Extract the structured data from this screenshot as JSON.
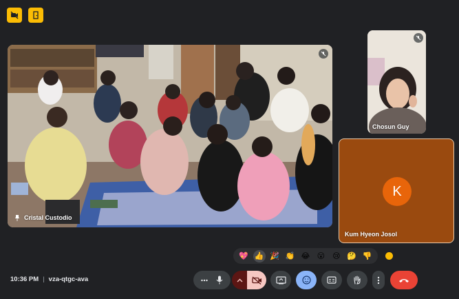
{
  "top_badges": [
    {
      "icon": "no-recording-icon"
    },
    {
      "icon": "door-icon"
    }
  ],
  "participants": {
    "main": {
      "name": "Cristal Custodio",
      "icon": "pin-icon"
    },
    "top_right": {
      "name": "Chosun Guy"
    },
    "bottom_right": {
      "name": "Kum Hyeon Josol",
      "avatar_letter": "K",
      "avatar_color": "#e8650a"
    }
  },
  "reactions": [
    {
      "emoji": "💖",
      "name": "sparkling-heart"
    },
    {
      "emoji": "👍",
      "name": "thumbs-up"
    },
    {
      "emoji": "🎉",
      "name": "party-popper"
    },
    {
      "emoji": "👏",
      "name": "clapping-hands"
    },
    {
      "emoji": "😂",
      "name": "tears-of-joy"
    },
    {
      "emoji": "😮",
      "name": "surprised"
    },
    {
      "emoji": "😢",
      "name": "crying"
    },
    {
      "emoji": "🤔",
      "name": "thinking"
    },
    {
      "emoji": "👎",
      "name": "thumbs-down"
    }
  ],
  "meeting": {
    "time": "10:36 PM",
    "separator": "|",
    "code": "vza-qtgc-ava"
  },
  "colors": {
    "background": "#202124",
    "accent_yellow": "#fbbc04",
    "leave_red": "#ea4335",
    "active_blue": "#8ab4f8"
  }
}
